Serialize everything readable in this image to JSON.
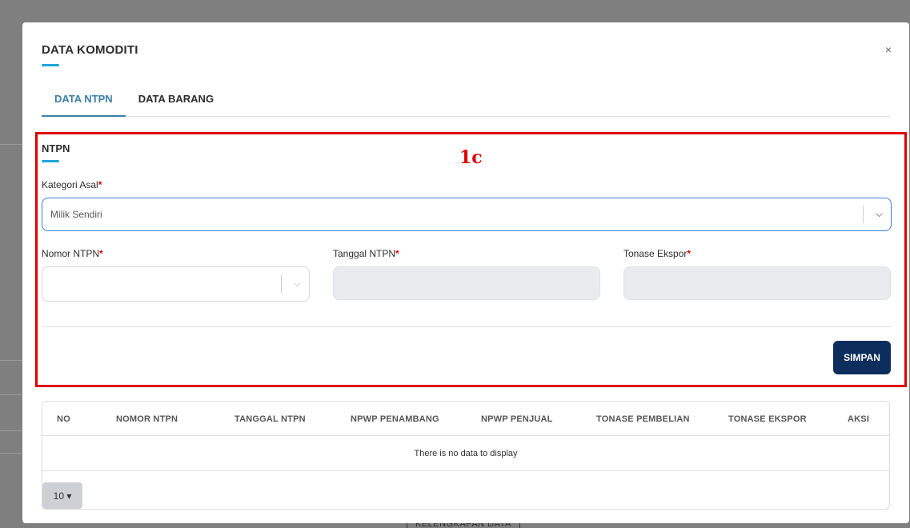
{
  "modal": {
    "title": "DATA KOMODITI",
    "close_icon": "×"
  },
  "tabs": [
    {
      "label": "DATA NTPN",
      "active": true
    },
    {
      "label": "DATA BARANG",
      "active": false
    }
  ],
  "section": {
    "title": "NTPN",
    "annotation": "1c",
    "kategori_asal": {
      "label": "Kategori Asal",
      "required": "*",
      "value": "Milik Sendiri",
      "chevron": "⌵"
    },
    "nomor_ntpn": {
      "label": "Nomor NTPN",
      "required": "*",
      "value": "",
      "chevron": "⌵"
    },
    "tanggal_ntpn": {
      "label": "Tanggal NTPN",
      "required": "*",
      "value": ""
    },
    "tonase_ekspor": {
      "label": "Tonase Ekspor",
      "required": "*",
      "value": ""
    },
    "save_label": "SIMPAN"
  },
  "table": {
    "columns": [
      "NO",
      "NOMOR NTPN",
      "TANGGAL NTPN",
      "NPWP PENAMBANG",
      "NPWP PENJUAL",
      "TONASE PEMBELIAN",
      "TONASE EKSPOR",
      "AKSI"
    ],
    "empty_text": "There is no data to display",
    "page_size": "10 ▾"
  },
  "background": {
    "bottom_text": "KELENGKAPAN DATA"
  },
  "colors": {
    "accent": "#1ea4d8",
    "tab_active": "#3d7fa6",
    "annotation": "#e00000",
    "primary_button": "#0d2e5c"
  }
}
